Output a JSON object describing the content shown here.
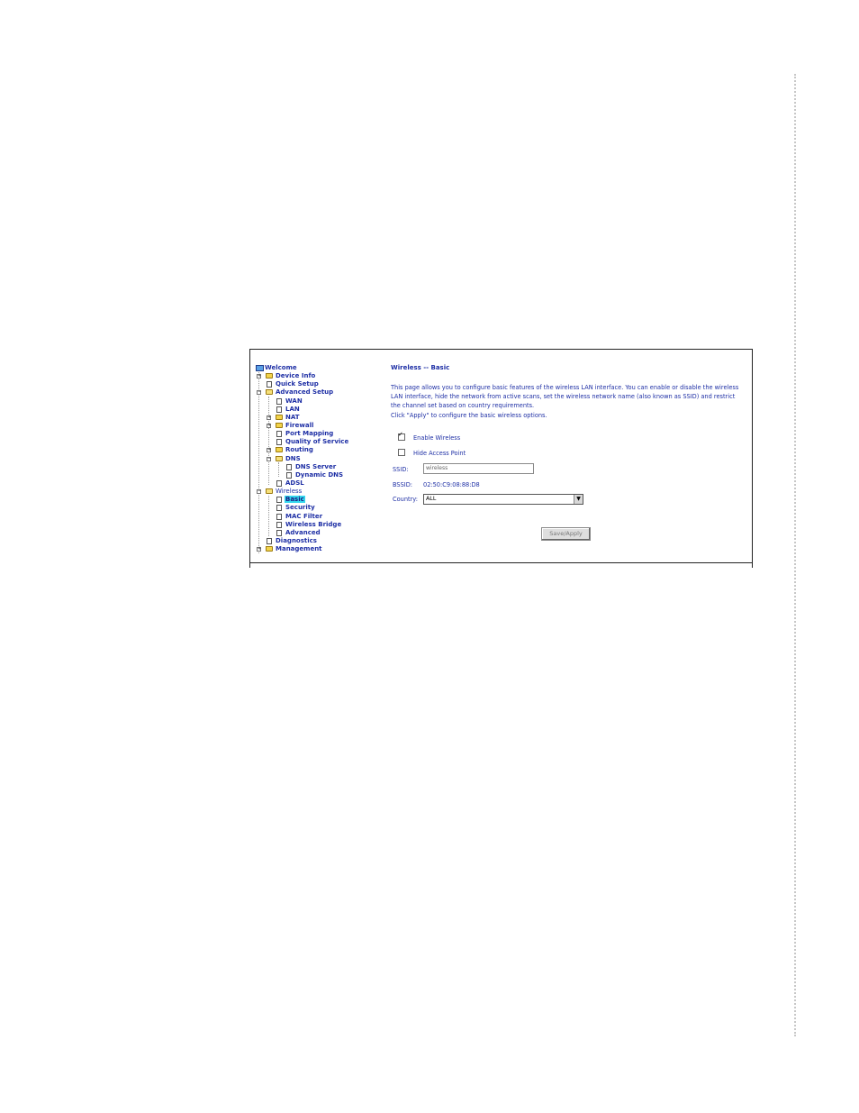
{
  "tree": {
    "root": "Welcome",
    "items": [
      {
        "label": "Device Info"
      },
      {
        "label": "Quick Setup"
      },
      {
        "label": "Advanced Setup"
      },
      {
        "label": "WAN"
      },
      {
        "label": "LAN"
      },
      {
        "label": "NAT"
      },
      {
        "label": "Firewall"
      },
      {
        "label": "Port Mapping"
      },
      {
        "label": "Quality of Service"
      },
      {
        "label": "Routing"
      },
      {
        "label": "DNS"
      },
      {
        "label": "DNS Server"
      },
      {
        "label": "Dynamic DNS"
      },
      {
        "label": "ADSL"
      },
      {
        "label": "Wireless"
      },
      {
        "label": "Basic"
      },
      {
        "label": "Security"
      },
      {
        "label": "MAC Filter"
      },
      {
        "label": "Wireless Bridge"
      },
      {
        "label": "Advanced"
      },
      {
        "label": "Diagnostics"
      },
      {
        "label": "Management"
      }
    ]
  },
  "content": {
    "title": "Wireless -- Basic",
    "description": "This page allows you to configure basic features of the wireless LAN interface. You can enable or disable the wireless LAN interface, hide the network from active scans, set the wireless network name (also known as SSID) and restrict the channel set based on country requirements.",
    "apply_hint": "Click \"Apply\" to configure the basic wireless options.",
    "enable_wireless": {
      "label": "Enable Wireless",
      "checked": true
    },
    "hide_ap": {
      "label": "Hide Access Point",
      "checked": false
    },
    "ssid_label": "SSID:",
    "ssid_value": "wireless",
    "bssid_label": "BSSID:",
    "bssid_value": "02:50:C9:08:88:D8",
    "country_label": "Country:",
    "country_value": "ALL",
    "save_label": "Save/Apply"
  }
}
